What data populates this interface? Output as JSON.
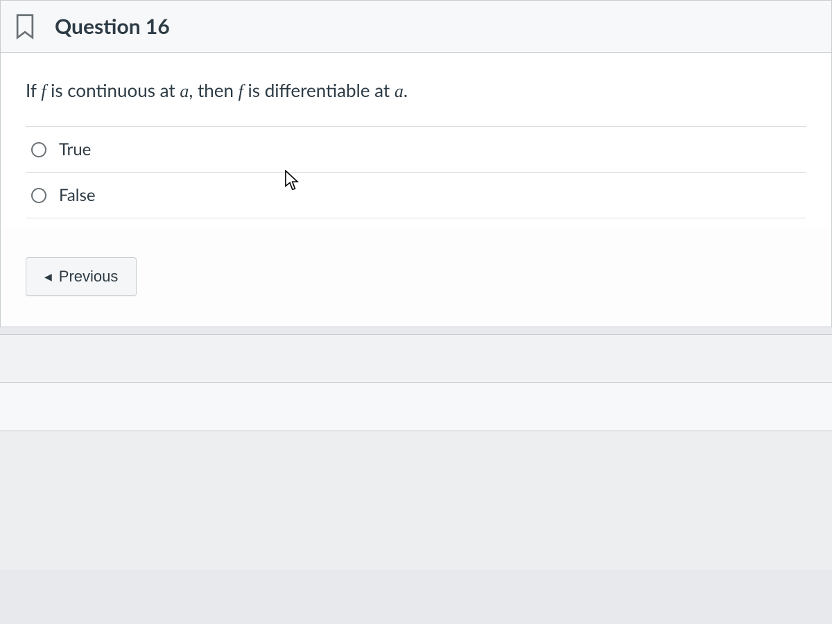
{
  "question": {
    "title": "Question 16",
    "prompt_pre": "If ",
    "prompt_f1": "f",
    "prompt_mid1": " is continuous at ",
    "prompt_a1": "a",
    "prompt_mid2": ", then ",
    "prompt_f2": "f",
    "prompt_mid3": " is differentiable at ",
    "prompt_a2": "a",
    "prompt_post": "."
  },
  "answers": [
    {
      "label": "True"
    },
    {
      "label": "False"
    }
  ],
  "nav": {
    "previous_label": "Previous"
  }
}
